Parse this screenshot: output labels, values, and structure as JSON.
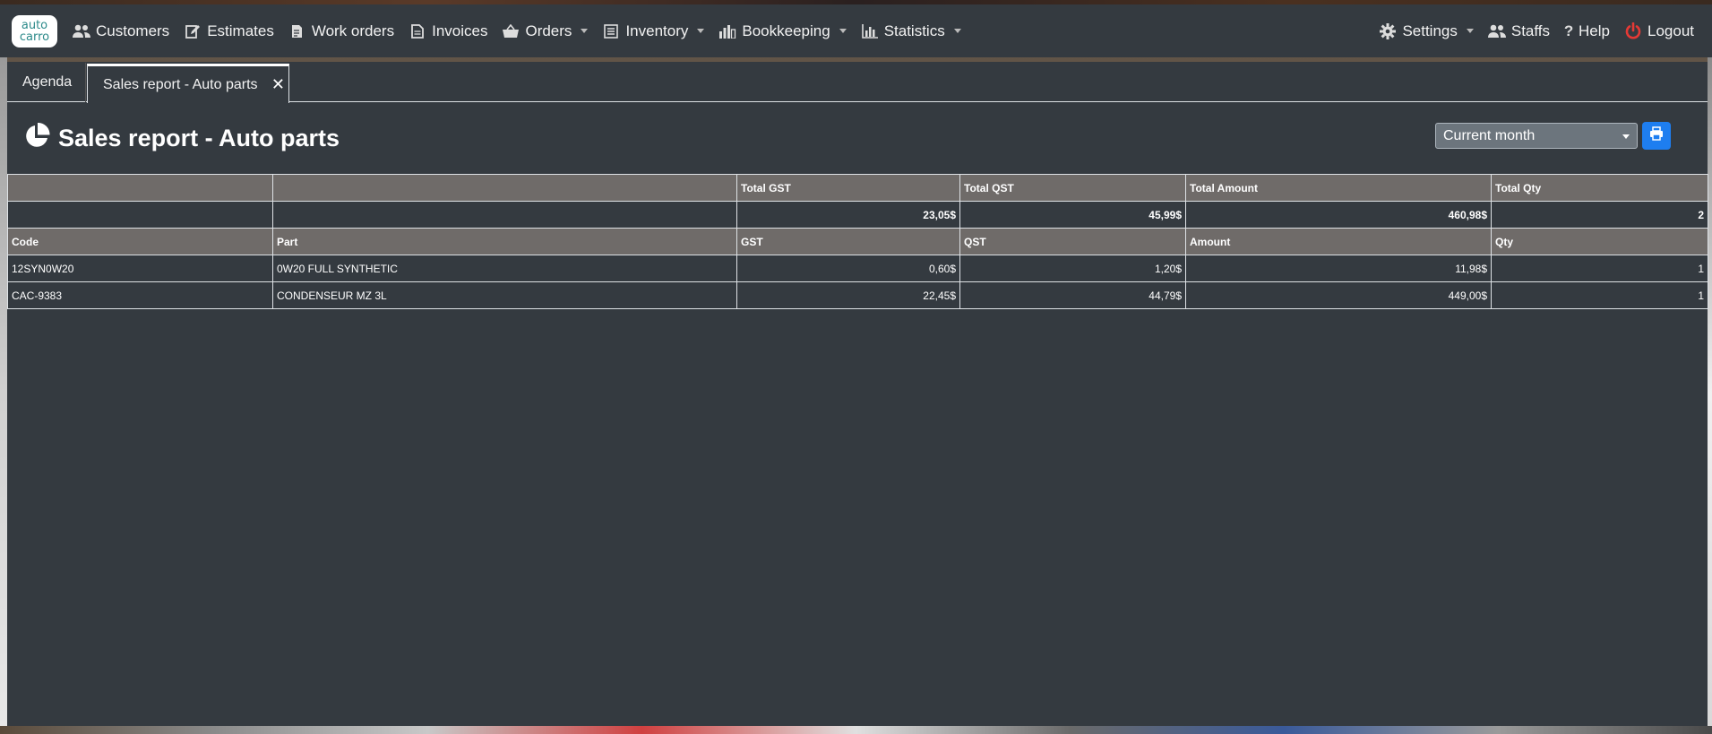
{
  "nav": {
    "logo_top": "auto",
    "logo_bottom": "carro",
    "left": [
      {
        "label": "Customers",
        "icon": "users-icon",
        "caret": false
      },
      {
        "label": "Estimates",
        "icon": "edit-icon",
        "caret": false
      },
      {
        "label": "Work orders",
        "icon": "document-edit-icon",
        "caret": false
      },
      {
        "label": "Invoices",
        "icon": "file-icon",
        "caret": false
      },
      {
        "label": "Orders",
        "icon": "basket-icon",
        "caret": true
      },
      {
        "label": "Inventory",
        "icon": "list-icon",
        "caret": true
      },
      {
        "label": "Bookkeeping",
        "icon": "ledger-icon",
        "caret": true
      },
      {
        "label": "Statistics",
        "icon": "bar-chart-icon",
        "caret": true
      }
    ],
    "right": [
      {
        "label": "Settings",
        "icon": "gear-icon",
        "caret": true
      },
      {
        "label": "Staffs",
        "icon": "users-icon",
        "caret": false
      },
      {
        "label": "Help",
        "icon": "question-icon",
        "caret": false
      },
      {
        "label": "Logout",
        "icon": "power-icon",
        "caret": false
      }
    ]
  },
  "tabs": {
    "agenda": "Agenda",
    "active": "Sales report - Auto parts",
    "close": "✕"
  },
  "page": {
    "title": "Sales report - Auto parts",
    "period": "Current month",
    "accent": "#1e7ef0",
    "logout_color": "#e53935"
  },
  "table": {
    "totals_header": [
      "",
      "",
      "Total GST",
      "Total QST",
      "Total Amount",
      "Total Qty"
    ],
    "totals": [
      "",
      "",
      "23,05$",
      "45,99$",
      "460,98$",
      "2"
    ],
    "columns": [
      "Code",
      "Part",
      "GST",
      "QST",
      "Amount",
      "Qty"
    ],
    "rows": [
      [
        "12SYN0W20",
        "0W20 FULL SYNTHETIC",
        "0,60$",
        "1,20$",
        "11,98$",
        "1"
      ],
      [
        "CAC-9383",
        "CONDENSEUR MZ 3L",
        "22,45$",
        "44,79$",
        "449,00$",
        "1"
      ]
    ]
  }
}
